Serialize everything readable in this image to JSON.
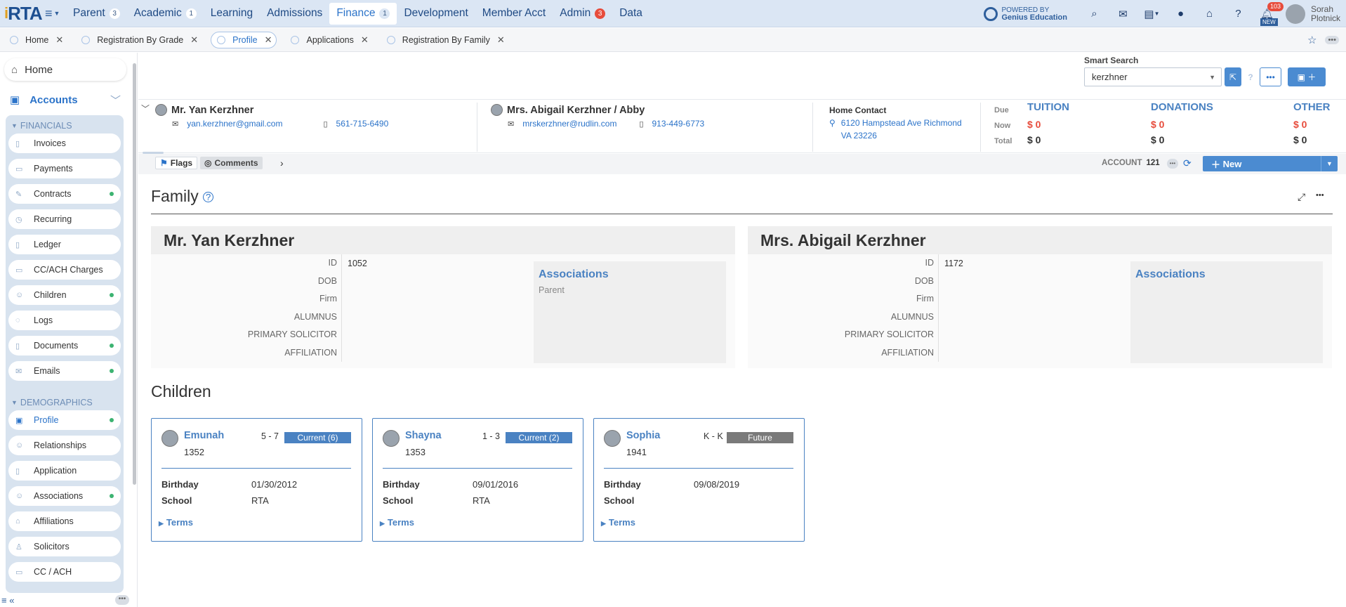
{
  "nav": {
    "logo": "RTA",
    "items": [
      {
        "label": "Parent",
        "badge": "3"
      },
      {
        "label": "Academic",
        "badge": "1"
      },
      {
        "label": "Learning",
        "badge": ""
      },
      {
        "label": "Admissions",
        "badge": ""
      },
      {
        "label": "Finance",
        "badge": "1"
      },
      {
        "label": "Development",
        "badge": ""
      },
      {
        "label": "Member Acct",
        "badge": ""
      },
      {
        "label": "Admin",
        "badge": "3"
      },
      {
        "label": "Data",
        "badge": ""
      }
    ],
    "powered_by": "POWERED BY",
    "powered_brand": "Genius Education",
    "notif_count": "103",
    "new_tag": "NEW",
    "user_first": "Sorah",
    "user_last": "Plotnick"
  },
  "tabs": [
    {
      "label": "Home"
    },
    {
      "label": "Registration By Grade"
    },
    {
      "label": "Profile"
    },
    {
      "label": "Applications"
    },
    {
      "label": "Registration By Family"
    }
  ],
  "sidebar": {
    "home": "Home",
    "accounts": "Accounts",
    "financials_title": "FINANCIALS",
    "financials": [
      "Invoices",
      "Payments",
      "Contracts",
      "Recurring",
      "Ledger",
      "CC/ACH Charges",
      "Children",
      "Logs",
      "Documents",
      "Emails"
    ],
    "demographics_title": "DEMOGRAPHICS",
    "demographics": [
      "Profile",
      "Relationships",
      "Application",
      "Associations",
      "Affiliations",
      "Solicitors",
      "CC / ACH"
    ]
  },
  "search": {
    "label": "Smart Search",
    "value": "kerzhner"
  },
  "header": {
    "parent1": {
      "name": "Mr. Yan Kerzhner",
      "email": "yan.kerzhner@gmail.com",
      "phone": "561-715-6490"
    },
    "parent2": {
      "name": "Mrs. Abigail Kerzhner / Abby",
      "email": "mrskerzhner@rudlin.com",
      "phone": "913-449-6773"
    },
    "home_contact_label": "Home Contact",
    "address_line1": "6120 Hampstead Ave Richmond",
    "address_line2": "VA 23226",
    "row_labels": [
      "Due",
      "Now",
      "Total"
    ],
    "tuition": {
      "title": "TUITION",
      "now": "$ 0",
      "total": "$ 0"
    },
    "donations": {
      "title": "DONATIONS",
      "now": "$ 0",
      "total": "$ 0"
    },
    "other": {
      "title": "OTHER",
      "now": "$ 0",
      "total": "$ 0"
    }
  },
  "flagsbar": {
    "flags": "Flags",
    "comments": "Comments",
    "account_label": "ACCOUNT",
    "account_number": "121",
    "new_button": "New"
  },
  "family": {
    "title": "Family",
    "field_labels": [
      "ID",
      "DOB",
      "Firm",
      "ALUMNUS",
      "PRIMARY SOLICITOR",
      "AFFILIATION"
    ],
    "associations_title": "Associations",
    "parent1": {
      "name": "Mr. Yan Kerzhner",
      "id": "1052",
      "association": "Parent"
    },
    "parent2": {
      "name": "Mrs. Abigail Kerzhner",
      "id": "1172",
      "association": ""
    }
  },
  "children": {
    "title": "Children",
    "birthday_label": "Birthday",
    "school_label": "School",
    "terms_label": "Terms",
    "kids": [
      {
        "name": "Emunah",
        "id": "1352",
        "grade": "5 - 7",
        "status": "Current  (6)",
        "status_color": "#4a82c2",
        "birthday": "01/30/2012",
        "school": "RTA"
      },
      {
        "name": "Shayna",
        "id": "1353",
        "grade": "1 - 3",
        "status": "Current  (2)",
        "status_color": "#4a82c2",
        "birthday": "09/01/2016",
        "school": "RTA"
      },
      {
        "name": "Sophia",
        "id": "1941",
        "grade": "K - K",
        "status": "Future",
        "status_color": "#7a7a7a",
        "birthday": "09/08/2019",
        "school": ""
      }
    ]
  }
}
